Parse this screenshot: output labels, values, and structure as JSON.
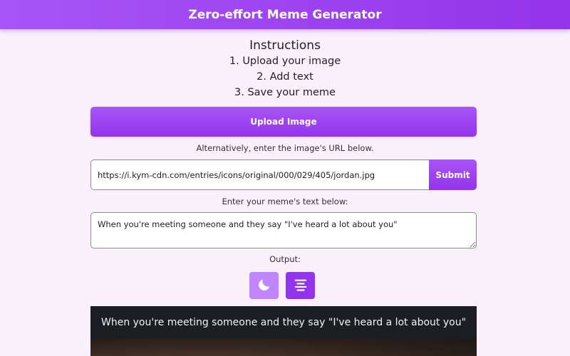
{
  "header": {
    "title": "Zero-effort Meme Generator"
  },
  "instructions": {
    "title": "Instructions",
    "steps": [
      "1. Upload your image",
      "2. Add text",
      "3. Save your meme"
    ]
  },
  "upload": {
    "label": "Upload Image"
  },
  "url_section": {
    "hint": "Alternatively, enter the image's URL below.",
    "value": "https://i.kym-cdn.com/entries/icons/original/000/029/405/jordan.jpg",
    "submit_label": "Submit"
  },
  "text_section": {
    "label": "Enter your meme's text below:",
    "value": "When you're meeting someone and they say \"I've heard a lot about you\""
  },
  "output": {
    "label": "Output:",
    "toggles": [
      {
        "icon": "moon-icon"
      },
      {
        "icon": "align-center-icon"
      }
    ],
    "caption": "When you're meeting someone and they say \"I've heard a lot about you\""
  },
  "colors": {
    "accent": "#9333ea",
    "accent_light": "#c084fc",
    "background": "#f9f0fc",
    "preview_bg": "#1b1f24"
  }
}
